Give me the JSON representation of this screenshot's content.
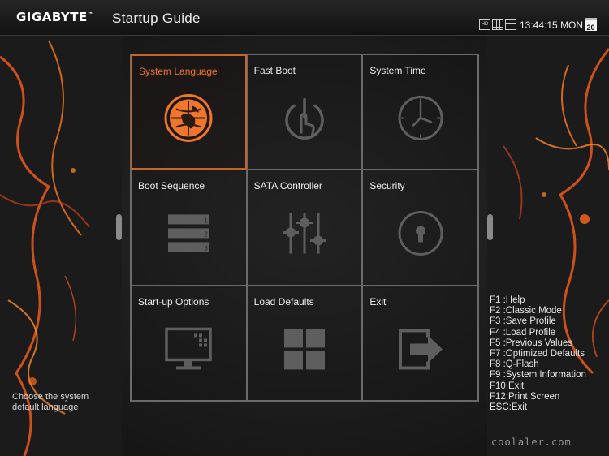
{
  "header": {
    "brand": "GIGABYTE",
    "brand_mark": "™",
    "title": "Startup Guide",
    "time": "13:44:15",
    "day": "MON",
    "date": "20",
    "view_modes": [
      "hd-icon",
      "grid-view-icon",
      "single-view-icon"
    ],
    "hd_label": "HD"
  },
  "tiles": [
    {
      "label": "System Language",
      "icon": "globe-icon",
      "active": true
    },
    {
      "label": "Fast Boot",
      "icon": "power-touch-icon",
      "active": false
    },
    {
      "label": "System Time",
      "icon": "clock-icon",
      "active": false
    },
    {
      "label": "Boot Sequence",
      "icon": "boot-list-icon",
      "active": false
    },
    {
      "label": "SATA Controller",
      "icon": "sliders-icon",
      "active": false
    },
    {
      "label": "Security",
      "icon": "keyhole-icon",
      "active": false
    },
    {
      "label": "Start-up Options",
      "icon": "monitor-icon",
      "active": false
    },
    {
      "label": "Load Defaults",
      "icon": "four-squares-icon",
      "active": false
    },
    {
      "label": "Exit",
      "icon": "exit-arrow-icon",
      "active": false
    }
  ],
  "boot_list_numbers": [
    "1",
    "2",
    "3"
  ],
  "description": "Choose the system default language",
  "hotkeys": [
    "F1 :Help",
    "F2 :Classic Mode",
    "F3 :Save Profile",
    "F4 :Load Profile",
    "F5 :Previous Values",
    "F7 :Optimized Defaults",
    "F8 :Q-Flash",
    "F9 :System Information",
    "F10:Exit",
    "F12:Print Screen",
    "ESC:Exit"
  ],
  "watermark": "coolaler.com",
  "colors": {
    "accent": "#f0762b",
    "icon_gray": "#5e5e5e",
    "grid_line": "#6a6a6a"
  }
}
